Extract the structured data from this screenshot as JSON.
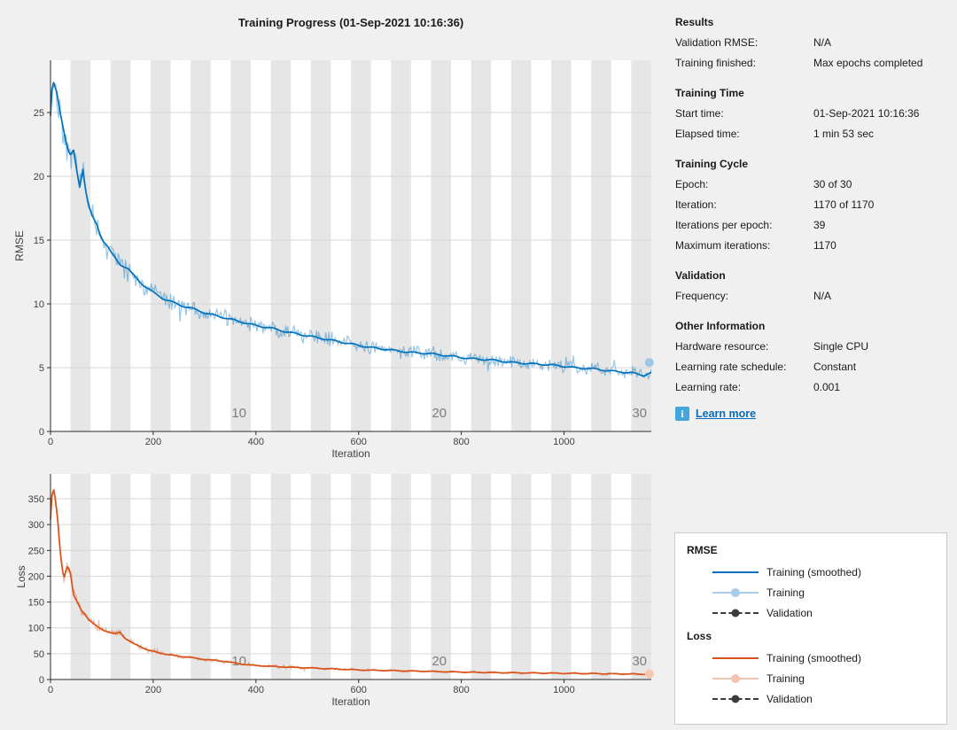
{
  "title": "Training Progress (01-Sep-2021 10:16:36)",
  "info_panel": {
    "sections": [
      {
        "header": "Results",
        "rows": [
          {
            "label": "Validation RMSE:",
            "value": "N/A"
          },
          {
            "label": "Training finished:",
            "value": "Max epochs completed"
          }
        ]
      },
      {
        "header": "Training Time",
        "rows": [
          {
            "label": "Start time:",
            "value": "01-Sep-2021 10:16:36"
          },
          {
            "label": "Elapsed time:",
            "value": "1 min 53 sec"
          }
        ]
      },
      {
        "header": "Training Cycle",
        "rows": [
          {
            "label": "Epoch:",
            "value": "30 of 30"
          },
          {
            "label": "Iteration:",
            "value": "1170 of 1170"
          },
          {
            "label": "Iterations per epoch:",
            "value": "39"
          },
          {
            "label": "Maximum iterations:",
            "value": "1170"
          }
        ]
      },
      {
        "header": "Validation",
        "rows": [
          {
            "label": "Frequency:",
            "value": "N/A"
          }
        ]
      },
      {
        "header": "Other Information",
        "rows": [
          {
            "label": "Hardware resource:",
            "value": "Single CPU"
          },
          {
            "label": "Learning rate schedule:",
            "value": "Constant"
          },
          {
            "label": "Learning rate:",
            "value": "0.001"
          }
        ]
      }
    ],
    "learn_more": {
      "label": "Learn more",
      "icon_glyph": "i"
    }
  },
  "chart_data": [
    {
      "type": "line",
      "name": "rmse",
      "title": "",
      "xlabel": "Iteration",
      "ylabel": "RMSE",
      "xlim": [
        0,
        1170
      ],
      "ylim": [
        0,
        29.1
      ],
      "xticks": [
        0,
        200,
        400,
        600,
        800,
        1000
      ],
      "yticks": [
        0,
        5,
        10,
        15,
        20,
        25
      ],
      "grid": "horizontal",
      "epochs": {
        "count": 30,
        "iterations_per_epoch": 39,
        "shaded": "even",
        "band_color": "#e6e6e6",
        "labels": [
          10,
          20,
          30
        ]
      },
      "series": [
        {
          "name": "Training (smoothed)",
          "color": "#0072BD",
          "anchors": [
            [
              0,
              24.7
            ],
            [
              3,
              26.8
            ],
            [
              6,
              27.3
            ],
            [
              12,
              26.6
            ],
            [
              18,
              25.2
            ],
            [
              25,
              23.8
            ],
            [
              32,
              22.4
            ],
            [
              38,
              21.6
            ],
            [
              45,
              22.0
            ],
            [
              52,
              20.2
            ],
            [
              57,
              19.2
            ],
            [
              63,
              20.6
            ],
            [
              68,
              19.0
            ],
            [
              75,
              17.6
            ],
            [
              82,
              16.8
            ],
            [
              90,
              16.2
            ],
            [
              100,
              15.1
            ],
            [
              110,
              14.6
            ],
            [
              120,
              13.9
            ],
            [
              135,
              13.1
            ],
            [
              150,
              12.8
            ],
            [
              165,
              12.1
            ],
            [
              180,
              11.5
            ],
            [
              200,
              10.9
            ],
            [
              220,
              10.4
            ],
            [
              240,
              10.1
            ],
            [
              260,
              9.8
            ],
            [
              280,
              9.6
            ],
            [
              300,
              9.3
            ],
            [
              320,
              9.1
            ],
            [
              340,
              8.9
            ],
            [
              360,
              8.7
            ],
            [
              380,
              8.5
            ],
            [
              400,
              8.3
            ],
            [
              430,
              8.1
            ],
            [
              460,
              7.8
            ],
            [
              500,
              7.5
            ],
            [
              540,
              7.2
            ],
            [
              580,
              6.9
            ],
            [
              620,
              6.6
            ],
            [
              660,
              6.4
            ],
            [
              700,
              6.2
            ],
            [
              740,
              6.1
            ],
            [
              780,
              5.9
            ],
            [
              820,
              5.7
            ],
            [
              860,
              5.6
            ],
            [
              900,
              5.4
            ],
            [
              940,
              5.3
            ],
            [
              980,
              5.2
            ],
            [
              1020,
              5.0
            ],
            [
              1060,
              4.9
            ],
            [
              1100,
              4.7
            ],
            [
              1130,
              4.6
            ],
            [
              1155,
              4.4
            ],
            [
              1170,
              4.6
            ]
          ]
        },
        {
          "name": "Training",
          "color": "rgba(0,114,189,0.40)",
          "derived_from": "Training (smoothed)",
          "noise": {
            "base": 0.3,
            "scale": 0.05
          },
          "seed": 42
        },
        {
          "name": "Validation",
          "values": "N/A"
        }
      ],
      "final_marker": {
        "x": 1166,
        "y": 5.4,
        "r": 5,
        "color": "#9cc7e6"
      }
    },
    {
      "type": "line",
      "name": "loss",
      "title": "",
      "xlabel": "Iteration",
      "ylabel": "Loss",
      "xlim": [
        0,
        1170
      ],
      "ylim": [
        0,
        398
      ],
      "xticks": [
        0,
        200,
        400,
        600,
        800,
        1000
      ],
      "yticks": [
        0,
        50,
        100,
        150,
        200,
        250,
        300,
        350
      ],
      "grid": "horizontal",
      "epochs": {
        "count": 30,
        "iterations_per_epoch": 39,
        "shaded": "even",
        "band_color": "#e6e6e6",
        "labels": [
          10,
          20,
          30
        ]
      },
      "series": [
        {
          "name": "Training (smoothed)",
          "color": "#D95319",
          "anchors": [
            [
              0,
              310
            ],
            [
              4,
              372
            ],
            [
              8,
              360
            ],
            [
              14,
              310
            ],
            [
              20,
              235
            ],
            [
              26,
              195
            ],
            [
              32,
              220
            ],
            [
              38,
              210
            ],
            [
              45,
              163
            ],
            [
              52,
              150
            ],
            [
              60,
              135
            ],
            [
              68,
              125
            ],
            [
              75,
              115
            ],
            [
              85,
              107
            ],
            [
              95,
              100
            ],
            [
              105,
              95
            ],
            [
              115,
              91
            ],
            [
              125,
              88
            ],
            [
              135,
              92
            ],
            [
              145,
              80
            ],
            [
              160,
              70
            ],
            [
              175,
              64
            ],
            [
              190,
              57
            ],
            [
              210,
              52
            ],
            [
              230,
              48
            ],
            [
              250,
              45
            ],
            [
              270,
              43
            ],
            [
              290,
              40
            ],
            [
              310,
              38
            ],
            [
              340,
              35
            ],
            [
              370,
              30
            ],
            [
              400,
              27
            ],
            [
              430,
              25.5
            ],
            [
              460,
              24
            ],
            [
              500,
              22.5
            ],
            [
              550,
              20.5
            ],
            [
              600,
              18.5
            ],
            [
              650,
              17.5
            ],
            [
              700,
              16.5
            ],
            [
              750,
              15.5
            ],
            [
              800,
              14.5
            ],
            [
              850,
              13.5
            ],
            [
              900,
              13
            ],
            [
              950,
              12.5
            ],
            [
              1000,
              12
            ],
            [
              1050,
              11.5
            ],
            [
              1100,
              11
            ],
            [
              1140,
              10.5
            ],
            [
              1170,
              10
            ]
          ]
        },
        {
          "name": "Training",
          "color": "rgba(217,83,25,0.38)",
          "derived_from": "Training (smoothed)",
          "noise": {
            "base": 1.5,
            "scale": 0.075
          },
          "seed": 7
        },
        {
          "name": "Validation",
          "values": "N/A"
        }
      ],
      "final_marker": {
        "x": 1166,
        "y": 11,
        "r": 5,
        "color": "#f5c6b1"
      }
    }
  ],
  "legend": {
    "groups": [
      {
        "title": "RMSE",
        "items": [
          {
            "label": "Training (smoothed)",
            "style": "solid",
            "line_color": "#0072BD",
            "marker_color": ""
          },
          {
            "label": "Training",
            "style": "line-marker",
            "line_color": "#a8cce9",
            "marker_color": "#a8cce9"
          },
          {
            "label": "Validation",
            "style": "dashed-marker",
            "line_color": "#3b3b3b",
            "marker_color": "#3b3b3b"
          }
        ]
      },
      {
        "title": "Loss",
        "items": [
          {
            "label": "Training (smoothed)",
            "style": "solid",
            "line_color": "#D95319",
            "marker_color": ""
          },
          {
            "label": "Training",
            "style": "line-marker",
            "line_color": "#f2c3ae",
            "marker_color": "#f2c3ae"
          },
          {
            "label": "Validation",
            "style": "dashed-marker",
            "line_color": "#3b3b3b",
            "marker_color": "#3b3b3b"
          }
        ]
      }
    ]
  },
  "colors": {
    "figure_background": "#f0f0f0",
    "plot_background": "#ffffff",
    "epoch_band": "#e6e6e6",
    "gridline": "#d6d6d6",
    "rmse_line": "#0072BD",
    "loss_line": "#D95319",
    "validation_line": "#3b3b3b",
    "link_blue": "#0b6cbd",
    "info_icon_blue": "#45a5dd"
  }
}
